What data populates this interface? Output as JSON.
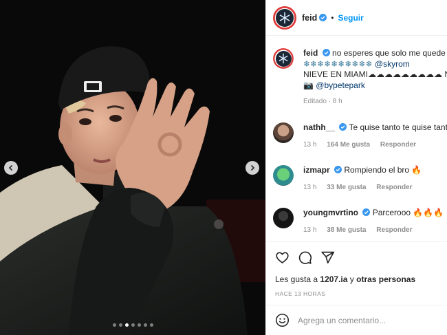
{
  "header": {
    "username": "feid",
    "separator": "•",
    "follow_label": "Seguir"
  },
  "caption": {
    "username": "feid",
    "line1": "no esperes que solo me quede",
    "line2_emoji": "❄❄❄❄❄❄❄❄❄❄",
    "line2_mention": "@skyrom",
    "line3": "NIEVE EN MIAMI☁☁☁☁☁☁☁☁☁ NI",
    "line4_camera": "📷",
    "line4_mention": "@bypetepark",
    "edited": "Editado · 8 h"
  },
  "comments": [
    {
      "username": "nathh__",
      "verified": true,
      "text": "Te quise tanto te quise tanto",
      "age": "13 h",
      "likes": "164 Me gusta",
      "reply": "Responder"
    },
    {
      "username": "izmapr",
      "verified": true,
      "text": "Rompiendo el bro 🔥",
      "age": "13 h",
      "likes": "33 Me gusta",
      "reply": "Responder"
    },
    {
      "username": "youngmvrtino",
      "verified": true,
      "text": "Parcerooo 🔥🔥🔥",
      "age": "13 h",
      "likes": "38 Me gusta",
      "reply": "Responder"
    }
  ],
  "likes": {
    "prefix": "Les gusta a",
    "user": "1207.ia",
    "middle": "y",
    "others": "otras personas"
  },
  "timestamp": "HACE 13 HORAS",
  "add_comment": {
    "placeholder": "Agrega un comentario..."
  },
  "carousel": {
    "total": 7,
    "active_index": 2
  },
  "colors": {
    "link_blue": "#0095f6",
    "verified_blue": "#3897f0",
    "muted": "#8e8e8e"
  },
  "icons": [
    "heart-icon",
    "comment-icon",
    "share-icon",
    "emoji-icon",
    "chevron-left-icon",
    "chevron-right-icon",
    "verified-icon"
  ]
}
